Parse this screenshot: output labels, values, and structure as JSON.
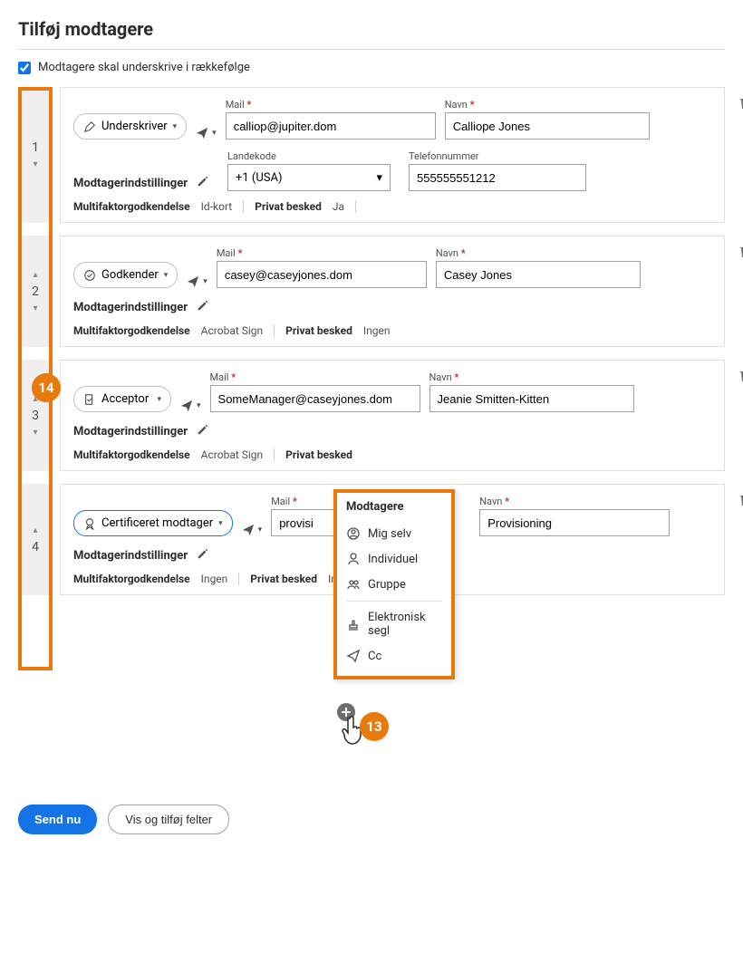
{
  "title": "Tilføj modtagere",
  "checkbox_label": "Modtagere skal underskrive i rækkefølge",
  "checkbox_checked": true,
  "labels": {
    "mail": "Mail",
    "name": "Navn",
    "country_code": "Landekode",
    "phone": "Telefonnummer",
    "settings": "Modtagerindstillinger",
    "mfa": "Multifaktorgodkendelse",
    "private_msg": "Privat besked"
  },
  "recipients": [
    {
      "order": "1",
      "up": false,
      "down": true,
      "role": "Underskriver",
      "mail": "calliop@jupiter.dom",
      "name": "Calliope Jones",
      "country_code": "+1 (USA)",
      "phone": "555555551212",
      "mfa": "Id-kort",
      "private_msg": "Ja"
    },
    {
      "order": "2",
      "up": true,
      "down": true,
      "role": "Godkender",
      "mail": "casey@caseyjones.dom",
      "name": "Casey Jones",
      "mfa": "Acrobat Sign",
      "private_msg": "Ingen"
    },
    {
      "order": "3",
      "up": true,
      "down": true,
      "role": "Acceptor",
      "mail": "SomeManager@caseyjones.dom",
      "name": "Jeanie Smitten-Kitten",
      "mfa": "Acrobat Sign",
      "private_msg_label_only": true
    },
    {
      "order": "4",
      "up": true,
      "down": false,
      "role": "Certificeret modtager",
      "role_active": true,
      "mail": "provisi",
      "name": "Provisioning",
      "mfa": "Ingen",
      "private_msg": "Ingen"
    }
  ],
  "popup": {
    "title": "Modtagere",
    "items": [
      "Mig selv",
      "Individuel",
      "Gruppe"
    ],
    "items2": [
      "Elektronisk segl",
      "Cc"
    ]
  },
  "callouts": {
    "c13": "13",
    "c14": "14"
  },
  "buttons": {
    "send": "Send nu",
    "show_fields": "Vis og tilføj felter"
  }
}
